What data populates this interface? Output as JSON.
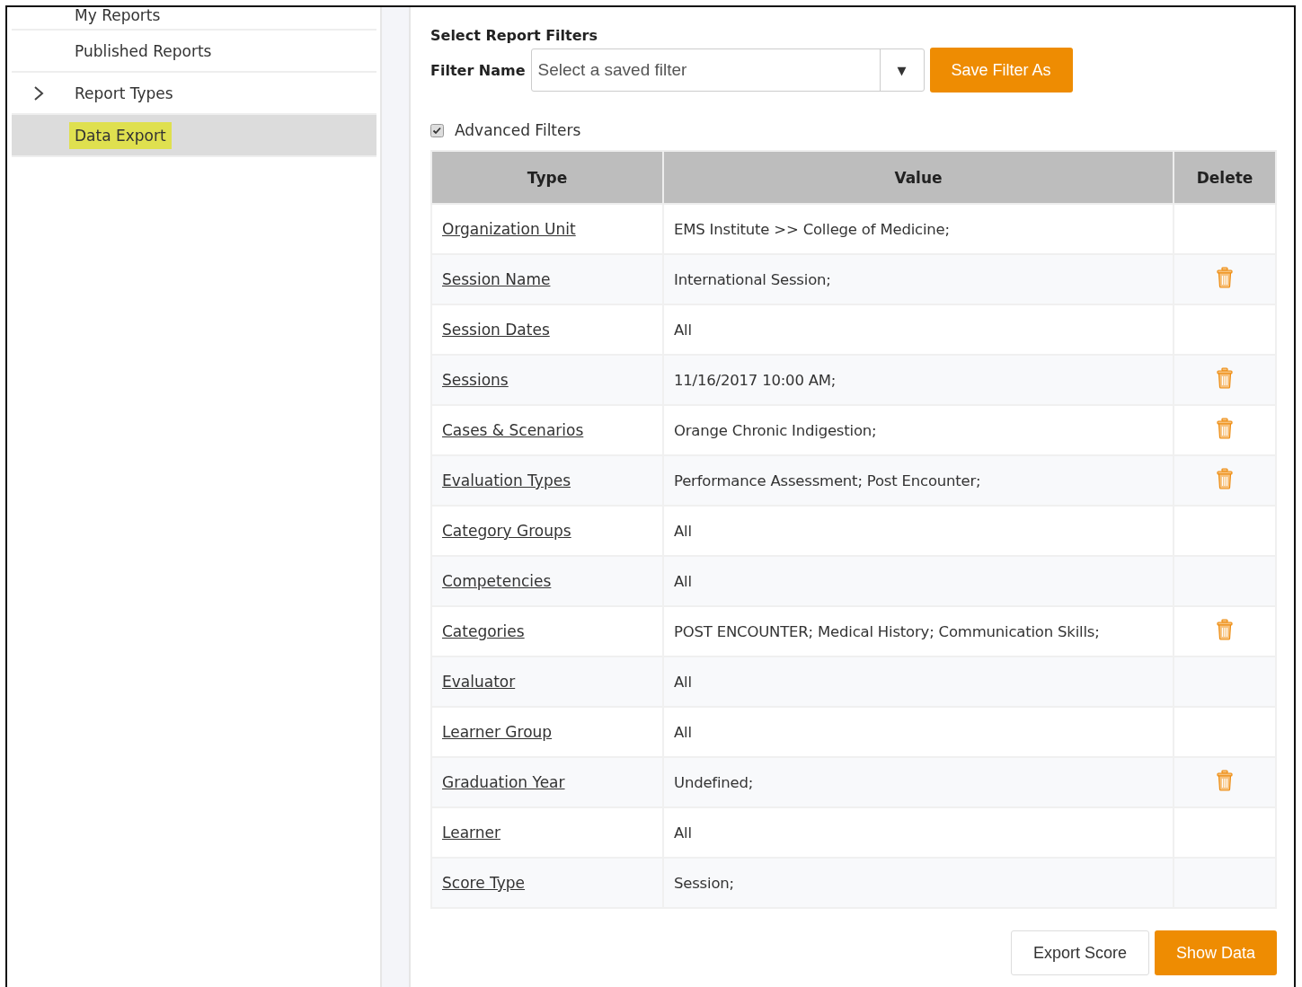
{
  "sidebar": {
    "items": [
      {
        "label": "My Reports",
        "selected": false
      },
      {
        "label": "Published Reports",
        "selected": false
      },
      {
        "label": "Report Types",
        "selected": false,
        "expanded": false
      },
      {
        "label": "Data Export",
        "selected": true
      }
    ]
  },
  "filters": {
    "title": "Select Report Filters",
    "filter_name_label": "Filter Name",
    "select": {
      "placeholder": "Select a saved filter",
      "caret": "▼"
    },
    "save_button": "Save Filter As",
    "advanced": {
      "label": "Advanced Filters",
      "checked": true
    }
  },
  "table": {
    "columns": [
      "Type",
      "Value",
      "Delete"
    ],
    "rows": [
      {
        "type": "Organization Unit",
        "value": "EMS Institute >> College of Medicine;",
        "deletable": false
      },
      {
        "type": "Session Name",
        "value": "International Session;",
        "deletable": true
      },
      {
        "type": "Session Dates",
        "value": "All",
        "deletable": false
      },
      {
        "type": "Sessions",
        "value": "11/16/2017 10:00 AM;",
        "deletable": true
      },
      {
        "type": "Cases & Scenarios",
        "value": "Orange Chronic Indigestion;",
        "deletable": true
      },
      {
        "type": "Evaluation Types",
        "value": "Performance Assessment; Post Encounter;",
        "deletable": true
      },
      {
        "type": "Category Groups",
        "value": "All",
        "deletable": false
      },
      {
        "type": "Competencies",
        "value": "All",
        "deletable": false
      },
      {
        "type": "Categories",
        "value": "POST ENCOUNTER; Medical History; Communication Skills;",
        "deletable": true
      },
      {
        "type": "Evaluator",
        "value": "All",
        "deletable": false
      },
      {
        "type": "Learner Group",
        "value": "All",
        "deletable": false
      },
      {
        "type": "Graduation Year",
        "value": "Undefined;",
        "deletable": true
      },
      {
        "type": "Learner",
        "value": "All",
        "deletable": false
      },
      {
        "type": "Score Type",
        "value": "Session;",
        "deletable": false
      }
    ]
  },
  "buttons": [
    {
      "label": "Export Score",
      "kind": "secondary"
    },
    {
      "label": "Show Data",
      "kind": "primary"
    }
  ]
}
